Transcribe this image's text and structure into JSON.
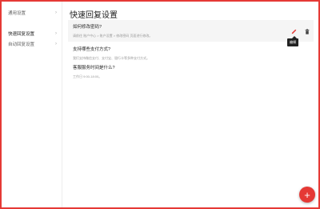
{
  "colors": {
    "accent": "#e53935",
    "border": "#e53935"
  },
  "sidebar": {
    "items": [
      {
        "label": "通用设置",
        "icon": "chevron-right-icon"
      },
      {
        "label": "快速回复设置",
        "icon": "chevron-right-icon",
        "active": true
      },
      {
        "label": "自动回复设置",
        "icon": "chevron-right-icon"
      }
    ]
  },
  "main": {
    "title": "快速回复设置",
    "replies": [
      {
        "question": "如何修改密码?",
        "answer": "请前往 账户中心 > 账户设置 > 修改密码 页面进行修改。"
      },
      {
        "question": "支持哪些支付方式?",
        "answer": "我们支持微信支付、支付宝、银行卡等多种支付方式。"
      },
      {
        "question": "客服服务时间是什么?",
        "answer": "工作日 9:00-18:00。"
      }
    ],
    "edit_tooltip": "编辑",
    "edit_icon": "pencil-icon",
    "delete_icon": "trash-icon",
    "fab_label": "+"
  }
}
